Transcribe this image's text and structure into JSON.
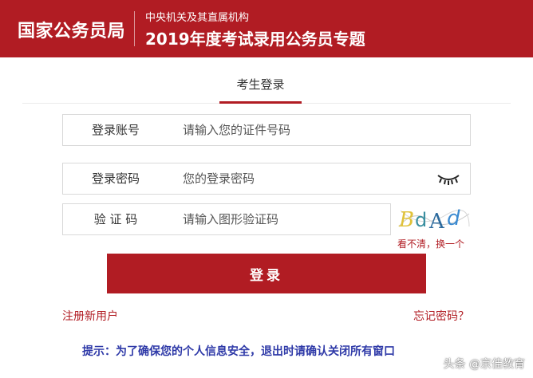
{
  "header": {
    "org_name": "国家公务员局",
    "subtitle_small": "中央机关及其直属机构",
    "subtitle_large": "2019年度考试录用公务员专题",
    "brand_color": "#b11c23"
  },
  "tabs": [
    {
      "label": "考生登录",
      "active": true
    }
  ],
  "form": {
    "account": {
      "label": "登录账号",
      "placeholder": "请输入您的证件号码",
      "value": ""
    },
    "password": {
      "label": "登录密码",
      "placeholder": "您的登录密码",
      "value": "",
      "toggle_icon": "eye-closed-icon"
    },
    "captcha": {
      "label": "验 证 码",
      "placeholder": "请输入图形验证码",
      "value": "",
      "image_text": "BdAd",
      "refresh_label": "看不清，换一个"
    }
  },
  "login_button": {
    "label": "登录"
  },
  "links": {
    "register": "注册新用户",
    "forgot_password": "忘记密码？"
  },
  "tip": "提示：为了确保您的个人信息安全，退出时请确认关闭所有窗口",
  "watermark": "头条 @京佳教育"
}
